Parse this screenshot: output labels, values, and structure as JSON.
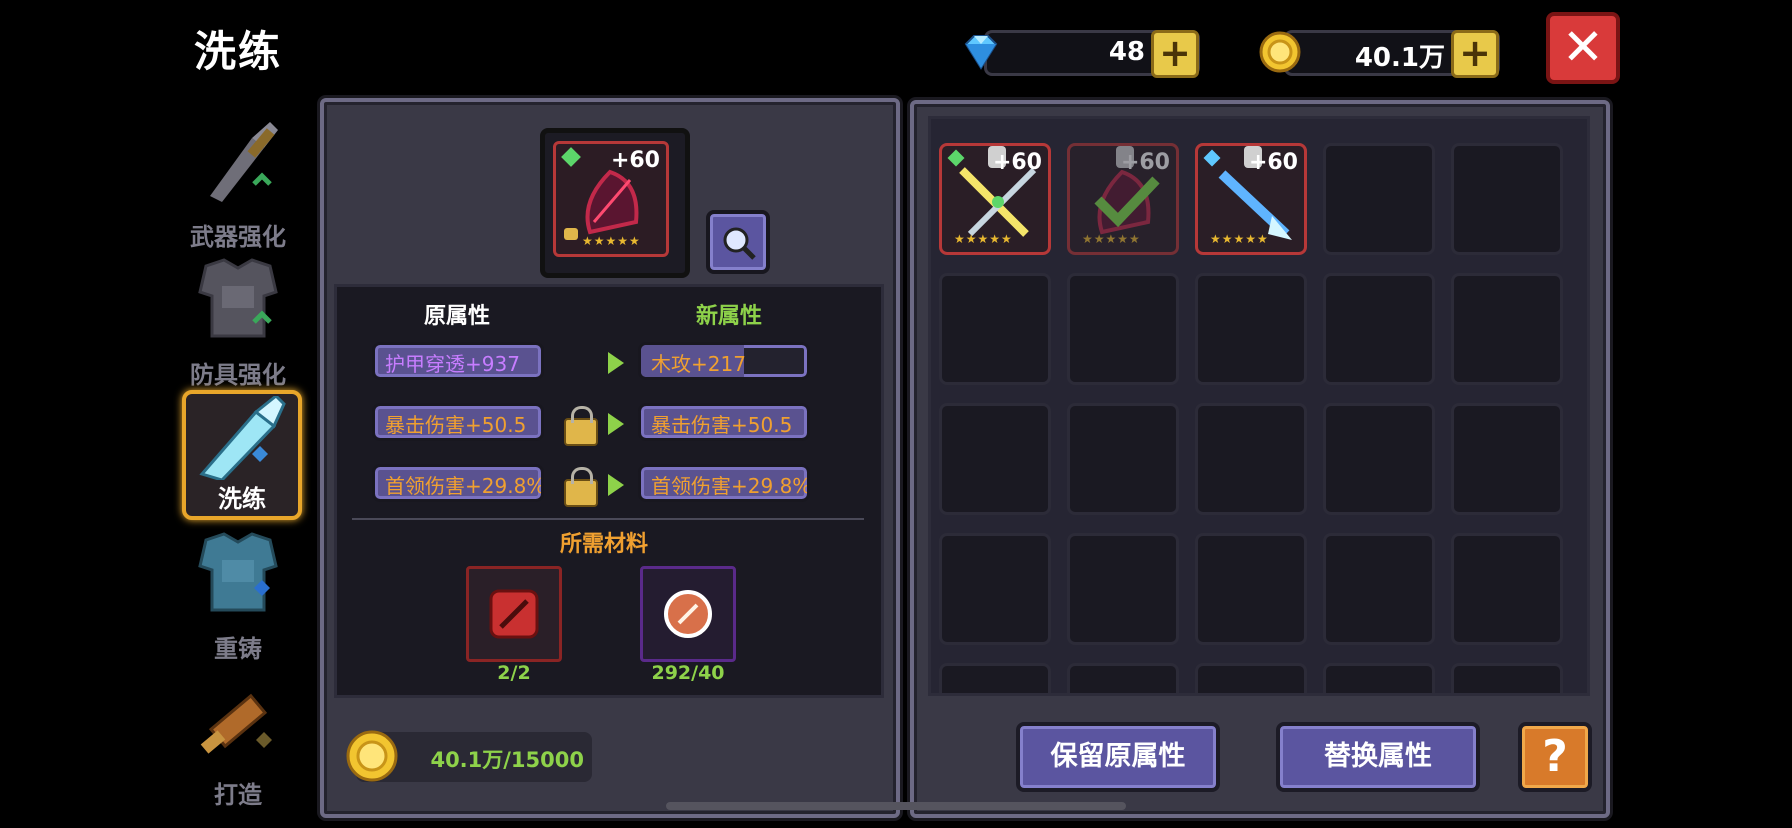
{
  "title": "洗练",
  "currency": {
    "gems": "48",
    "coins": "40.1万",
    "plus_label": "+"
  },
  "close_label": "✕",
  "sidebar": {
    "items": [
      {
        "label": "武器强化",
        "active": false
      },
      {
        "label": "防具强化",
        "active": false
      },
      {
        "label": "洗练",
        "active": true
      },
      {
        "label": "重铸",
        "active": false
      },
      {
        "label": "打造",
        "active": false
      }
    ]
  },
  "equipped_item": {
    "level": "+60",
    "stars": "★★★★★"
  },
  "attributes": {
    "old_header": "原属性",
    "new_header": "新属性",
    "rows": [
      {
        "old": "护甲穿透+937",
        "new": "木攻+217"
      },
      {
        "old": "暴击伤害+50.5",
        "new": "暴击伤害+50.5"
      },
      {
        "old": "首领伤害+29.8%",
        "new": "首领伤害+29.8%"
      }
    ],
    "new_bar_progress": 0.62
  },
  "materials": {
    "header": "所需材料",
    "items": [
      {
        "count": "2/2"
      },
      {
        "count": "292/40"
      }
    ]
  },
  "cost": "40.1万/15000",
  "inventory": {
    "items": [
      {
        "level": "+60",
        "stars": "★★★★★"
      },
      {
        "level": "+60",
        "stars": "★★★★★"
      },
      {
        "level": "+60",
        "stars": "★★★★★"
      }
    ]
  },
  "buttons": {
    "keep": "保留原属性",
    "replace": "替换属性",
    "help": "?"
  },
  "colors": {
    "old_text": "#c77dff",
    "same_text": "#f0a030",
    "new_text": "#c77dff",
    "new_header": "#8ed24a",
    "material_header": "#f0a030",
    "count_green": "#8ed24a",
    "accent_gold": "#e8b830"
  }
}
